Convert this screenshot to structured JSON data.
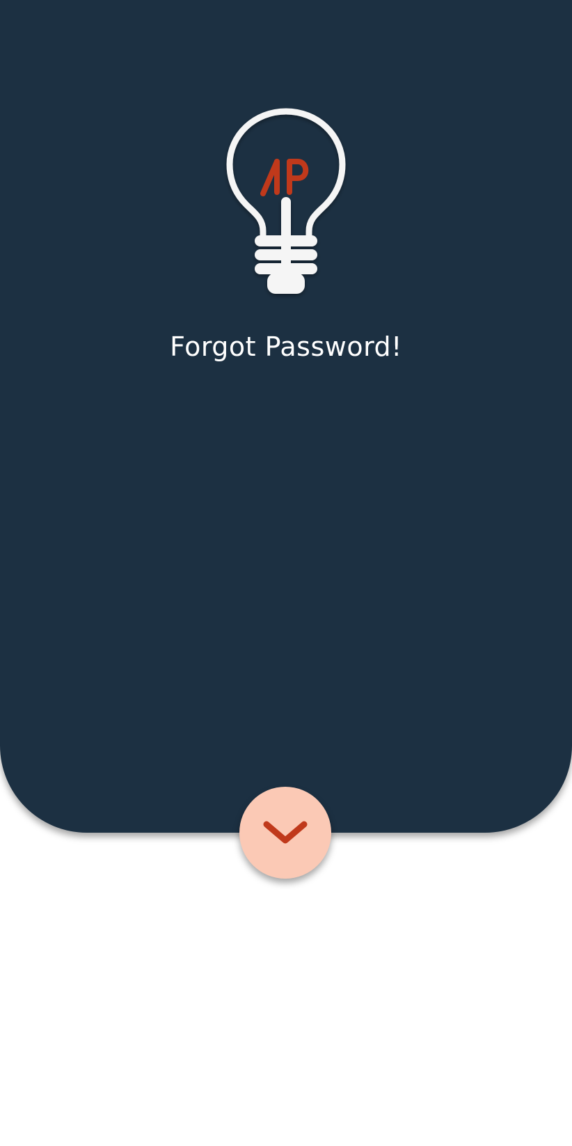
{
  "screen": {
    "title": "Forgot Password!"
  },
  "logo": {
    "icon": "lightbulb-logo-icon",
    "monogram": "AP"
  },
  "expand_button": {
    "icon": "chevron-down-icon"
  },
  "colors": {
    "panel_background": "#1c3042",
    "page_background": "#ffffff",
    "title_text": "#ffffff",
    "bulb": "#f5f5f5",
    "accent": "#c0391b",
    "button_background": "#fbc9b5"
  }
}
